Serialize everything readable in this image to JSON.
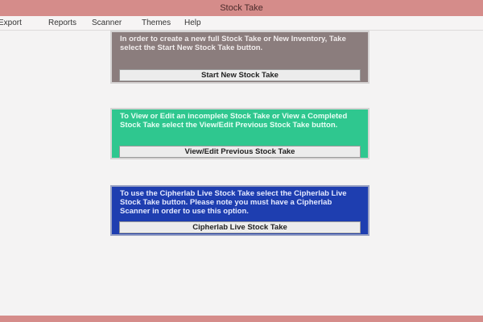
{
  "window": {
    "title": "Stock Take"
  },
  "menu": {
    "items": [
      "Export",
      "Reports",
      "Scanner",
      "Themes",
      "Help"
    ]
  },
  "panels": [
    {
      "message": "In order to create a new full Stock Take or New Inventory, Take select the Start New Stock Take button.",
      "button": "Start New Stock Take"
    },
    {
      "message": "To View or Edit an incomplete Stock Take or View a Completed Stock Take select the View/Edit Previous Stock Take button.",
      "button": "View/Edit Previous Stock Take"
    },
    {
      "message": "To use the Cipherlab Live Stock Take select the Cipherlab Live Stock Take button. Please note you must have a Cipherlab Scanner in order to use this option.",
      "button": "Cipherlab Live Stock Take"
    }
  ],
  "colors": {
    "titlebar": "#d58c8a",
    "panel_1": "#8b7d7d",
    "panel_2": "#2fc78f",
    "panel_3": "#1e3eb0"
  }
}
